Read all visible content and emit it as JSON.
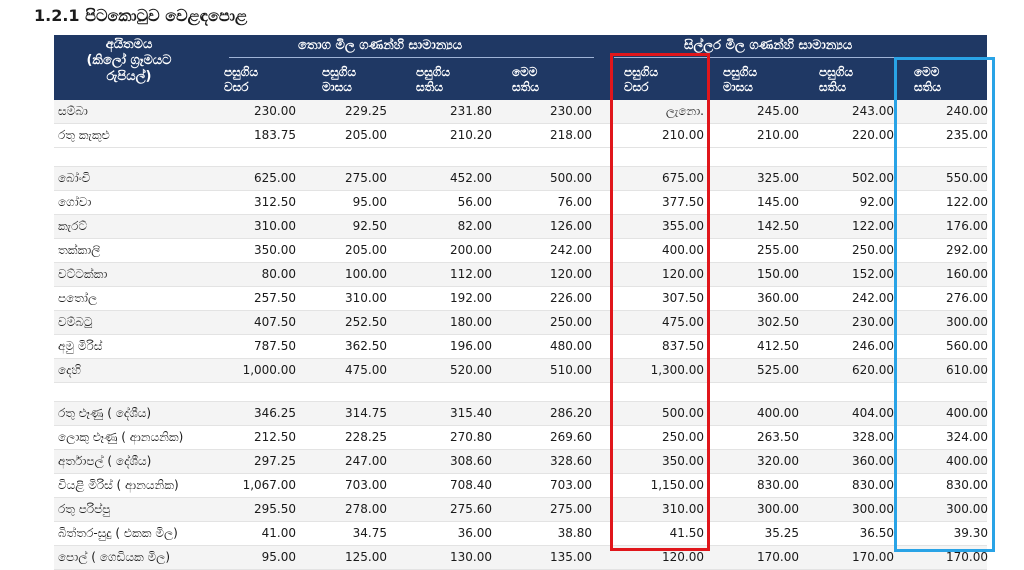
{
  "title": "1.2.1 පිටකොටුව වෙළඳපොළ",
  "header": {
    "item_col": "අයිතමය\n(කිලෝ ග්‍රෑමයට\nරුපියල්)",
    "wholesale_group": "තොග මිල ගණන්හි සාමාන්‍යය",
    "retail_group": "සිල්ලර මිල ගණන්හි සාමාන්‍යය",
    "sub": [
      "පසුගිය\nවසර",
      "පසුගිය\nමාසය",
      "පසුගිය\nසතිය",
      "මෙම\nසතිය",
      "පසුගිය\nවසර",
      "පසුගිය\nමාසය",
      "පසුගිය\nසතිය",
      "මෙම\nසතිය"
    ]
  },
  "groups": [
    {
      "rows": [
        {
          "name": "සම්බා",
          "values": [
            "230.00",
            "229.25",
            "231.80",
            "230.00",
            "ලැනො.",
            "245.00",
            "243.00",
            "240.00"
          ]
        },
        {
          "name": "රතු කැකුළු",
          "values": [
            "183.75",
            "205.00",
            "210.20",
            "218.00",
            "210.00",
            "210.00",
            "220.00",
            "235.00"
          ]
        }
      ]
    },
    {
      "rows": [
        {
          "name": "බෝංචි",
          "values": [
            "625.00",
            "275.00",
            "452.00",
            "500.00",
            "675.00",
            "325.00",
            "502.00",
            "550.00"
          ]
        },
        {
          "name": "ගෝවා",
          "values": [
            "312.50",
            "95.00",
            "56.00",
            "76.00",
            "377.50",
            "145.00",
            "92.00",
            "122.00"
          ]
        },
        {
          "name": "කැරට්",
          "values": [
            "310.00",
            "92.50",
            "82.00",
            "126.00",
            "355.00",
            "142.50",
            "122.00",
            "176.00"
          ]
        },
        {
          "name": "තක්කාලි",
          "values": [
            "350.00",
            "205.00",
            "200.00",
            "242.00",
            "400.00",
            "255.00",
            "250.00",
            "292.00"
          ]
        },
        {
          "name": "වට්ටක්කා",
          "values": [
            "80.00",
            "100.00",
            "112.00",
            "120.00",
            "120.00",
            "150.00",
            "152.00",
            "160.00"
          ]
        },
        {
          "name": "පතෝල",
          "values": [
            "257.50",
            "310.00",
            "192.00",
            "226.00",
            "307.50",
            "360.00",
            "242.00",
            "276.00"
          ]
        },
        {
          "name": "වම්බටු",
          "values": [
            "407.50",
            "252.50",
            "180.00",
            "250.00",
            "475.00",
            "302.50",
            "230.00",
            "300.00"
          ]
        },
        {
          "name": "අමු මිරිස්",
          "values": [
            "787.50",
            "362.50",
            "196.00",
            "480.00",
            "837.50",
            "412.50",
            "246.00",
            "560.00"
          ]
        },
        {
          "name": "දෙහි",
          "values": [
            "1,000.00",
            "475.00",
            "520.00",
            "510.00",
            "1,300.00",
            "525.00",
            "620.00",
            "610.00"
          ]
        }
      ]
    },
    {
      "rows": [
        {
          "name": "රතු ළූණු ( දේශීය)",
          "values": [
            "346.25",
            "314.75",
            "315.40",
            "286.20",
            "500.00",
            "400.00",
            "404.00",
            "400.00"
          ]
        },
        {
          "name": "ලොකු ළූණු ( ආනයනික)",
          "values": [
            "212.50",
            "228.25",
            "270.80",
            "269.60",
            "250.00",
            "263.50",
            "328.00",
            "324.00"
          ]
        },
        {
          "name": "අර්තාපල් ( දේශීය)",
          "values": [
            "297.25",
            "247.00",
            "308.60",
            "328.60",
            "350.00",
            "320.00",
            "360.00",
            "400.00"
          ]
        },
        {
          "name": "වියළි මිරිස් ( ආනයනික)",
          "values": [
            "1,067.00",
            "703.00",
            "708.40",
            "703.00",
            "1,150.00",
            "830.00",
            "830.00",
            "830.00"
          ]
        },
        {
          "name": "රතු පරිප්පු",
          "values": [
            "295.50",
            "278.00",
            "275.60",
            "275.00",
            "310.00",
            "300.00",
            "300.00",
            "300.00"
          ]
        },
        {
          "name": "බිත්තර-සුදු ( එකක මිල)",
          "values": [
            "41.00",
            "34.75",
            "36.00",
            "38.80",
            "41.50",
            "35.25",
            "36.50",
            "39.30"
          ]
        },
        {
          "name": "පොල් ( ගෙඩියක මිල)",
          "values": [
            "95.00",
            "125.00",
            "130.00",
            "135.00",
            "120.00",
            "170.00",
            "170.00",
            "170.00"
          ]
        }
      ]
    }
  ],
  "highlight_colors": {
    "red_box": "#e0161b",
    "blue_box": "#29a3e6",
    "header_bg": "#1f3864"
  }
}
